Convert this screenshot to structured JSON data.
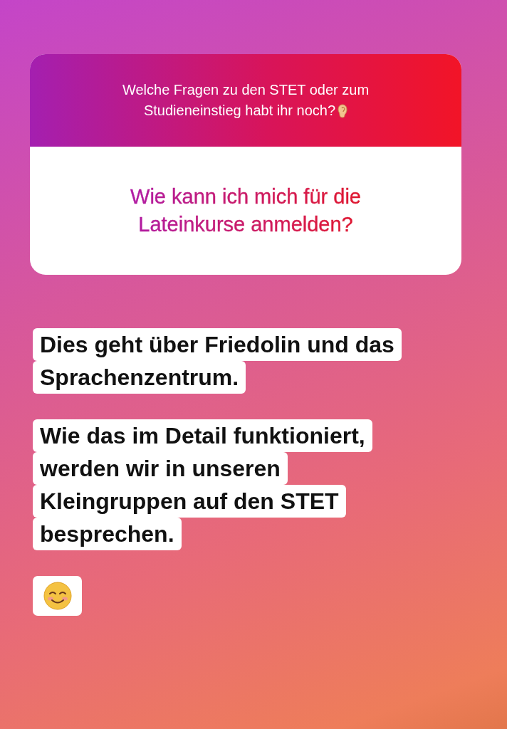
{
  "question_card": {
    "prompt": "Welche Fragen zu den STET oder zum Studieneinstieg habt ihr noch?",
    "answer": "Wie kann ich mich für die Lateinkurse anmelden?"
  },
  "reply_paragraphs": [
    {
      "lines": [
        "Dies geht über Friedolin und das",
        "Sprachenzentrum."
      ]
    },
    {
      "lines": [
        "Wie das im Detail funktioniert,",
        "werden wir in unseren",
        "Kleingruppen auf den STET",
        "besprechen."
      ]
    }
  ]
}
